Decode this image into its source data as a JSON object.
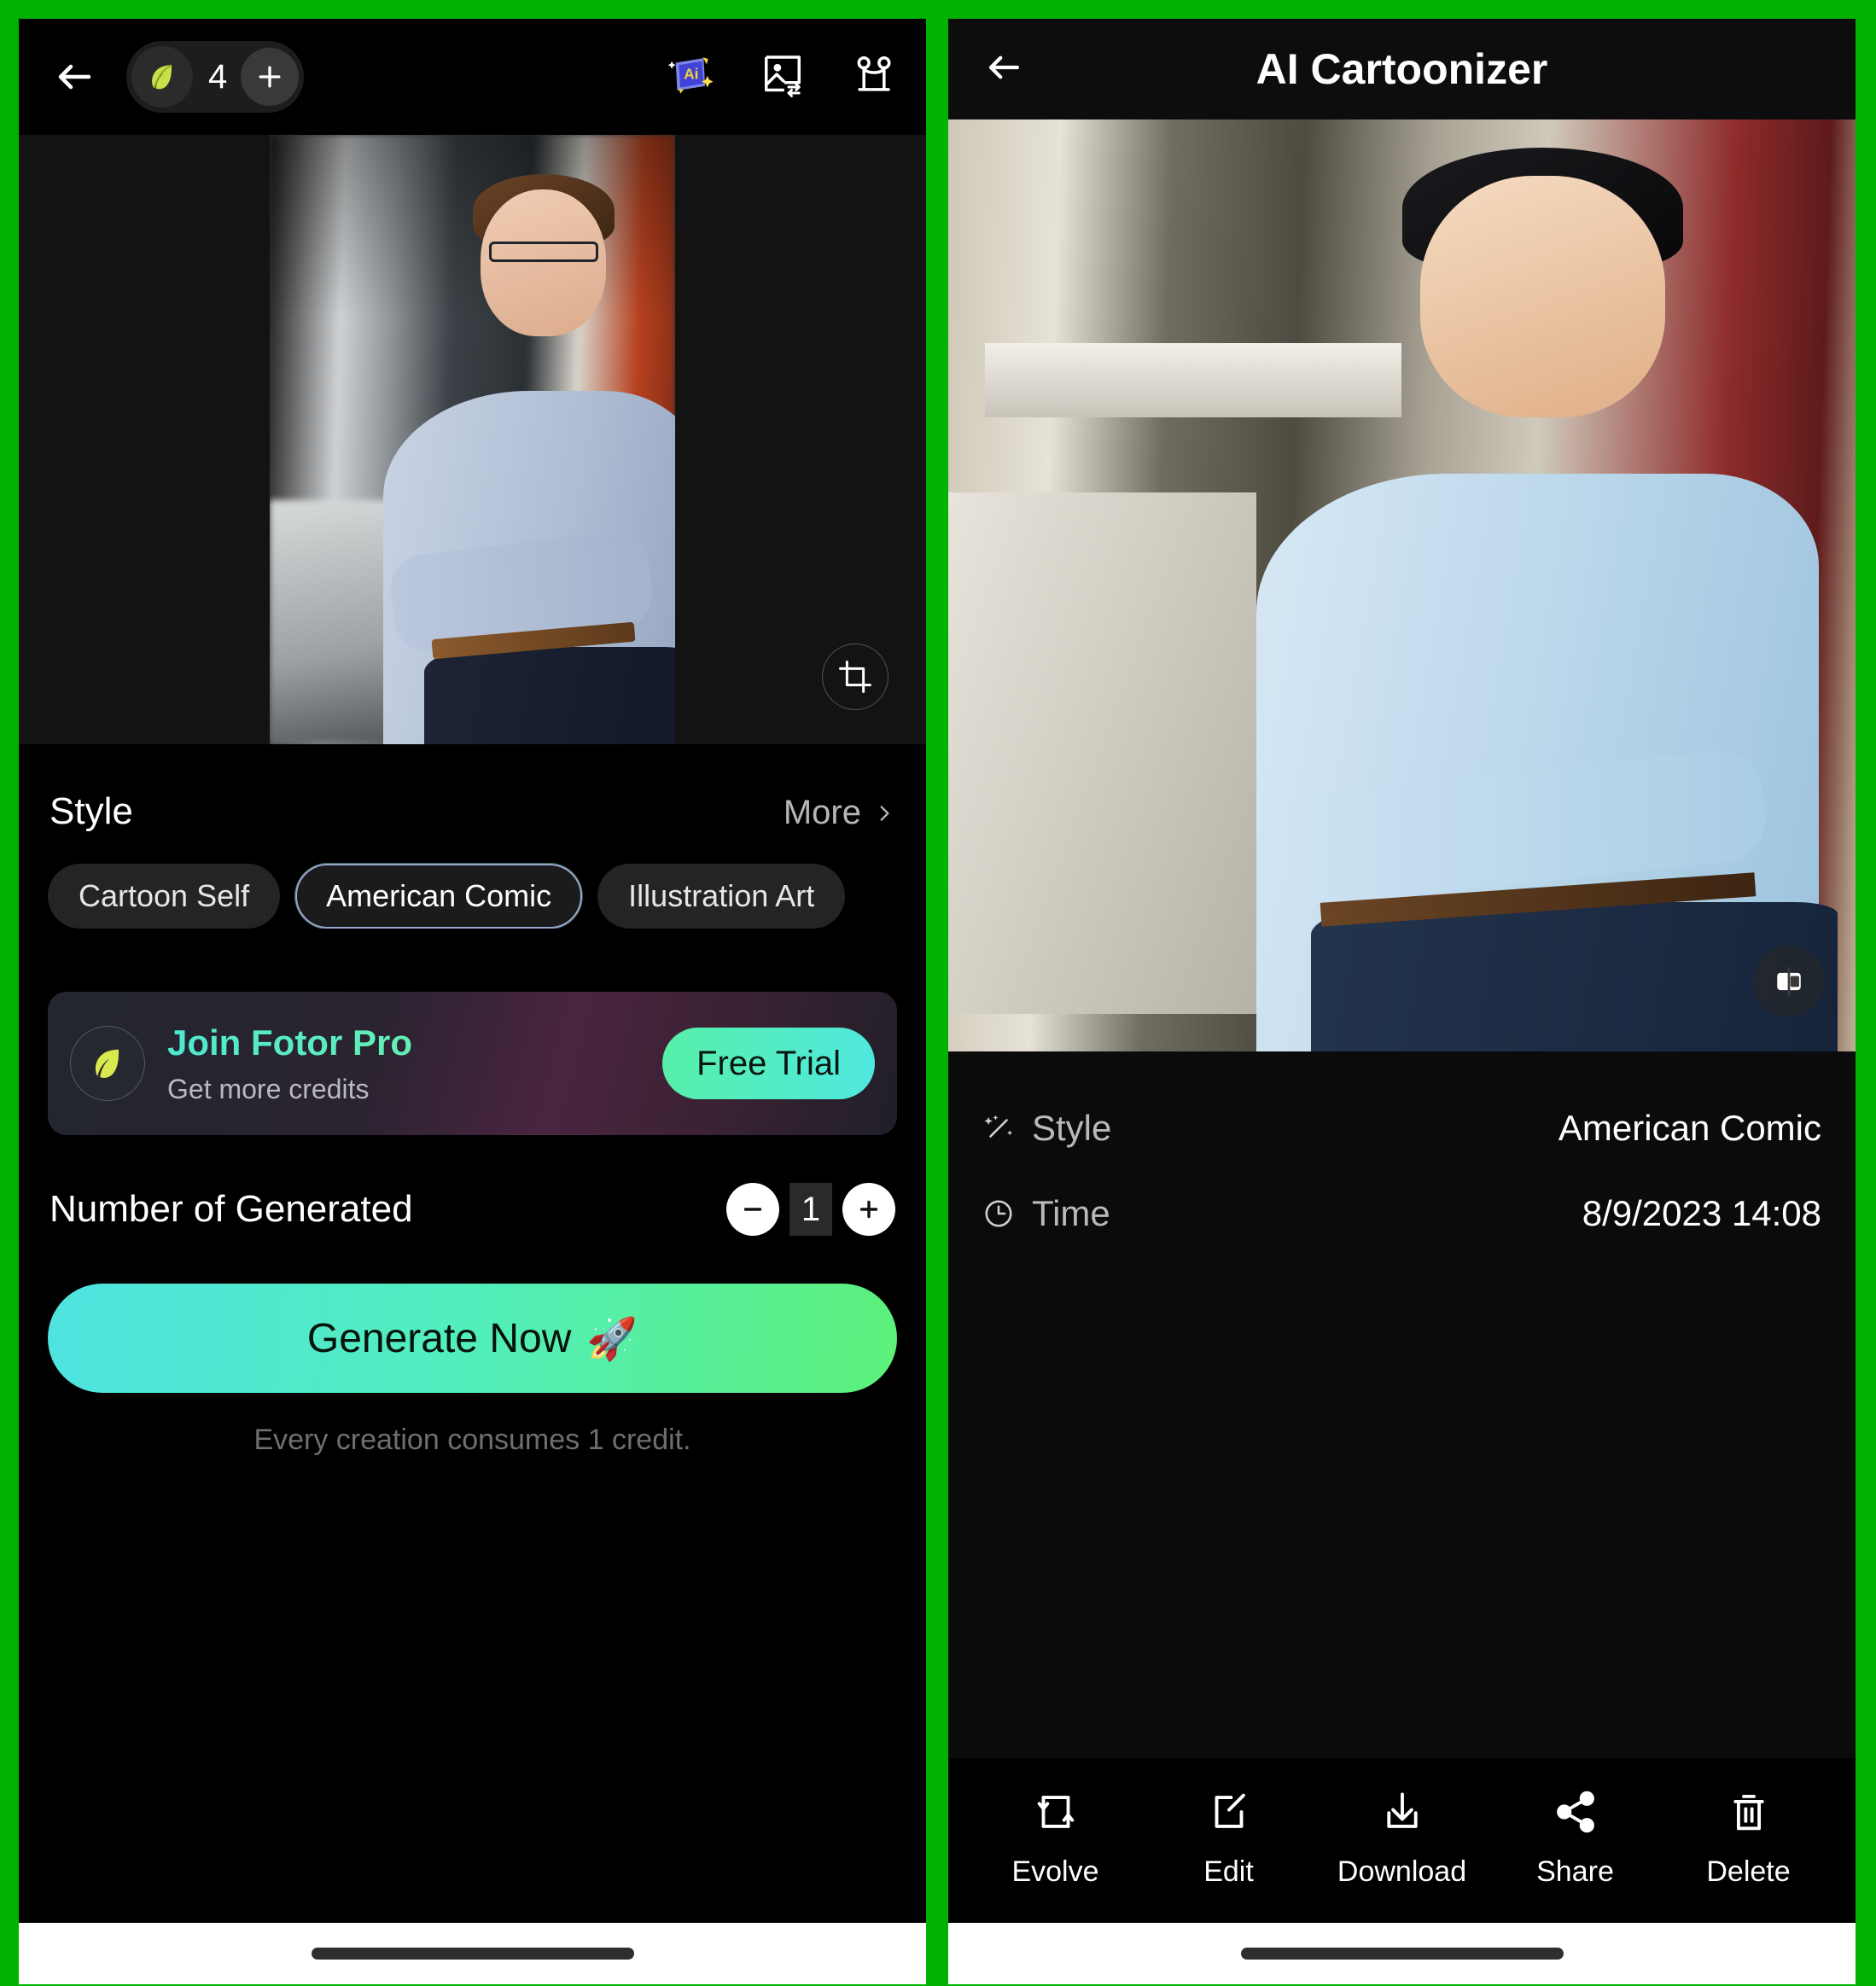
{
  "theme": {
    "divider_color": "#00b300",
    "background": "#000000",
    "accent_gradient_start": "#4fe3e0",
    "accent_gradient_end": "#5cf07a",
    "pro_title_color": "#4ee8d0"
  },
  "left_panel": {
    "topbar": {
      "back_icon": "back-arrow-icon",
      "credits": {
        "icon": "leaf-icon",
        "count": "4",
        "add_label": "+"
      },
      "actions": [
        {
          "icon": "ai-magic-banner-icon",
          "name": "ai-tools"
        },
        {
          "icon": "image-swap-icon",
          "name": "replace-image"
        },
        {
          "icon": "canvas-expand-icon",
          "name": "expand-canvas"
        }
      ]
    },
    "preview": {
      "crop_icon": "crop-icon",
      "alt": "original photo of man in light blue shirt with arms crossed"
    },
    "style_section": {
      "title": "Style",
      "more_label": "More",
      "more_icon": "chevron-right-icon",
      "chips": [
        {
          "label": "Cartoon Self",
          "selected": false
        },
        {
          "label": "American Comic",
          "selected": true
        },
        {
          "label": "Illustration Art",
          "selected": false
        }
      ]
    },
    "pro_banner": {
      "icon": "leaf-icon",
      "title": "Join Fotor Pro",
      "subtitle": "Get more credits",
      "cta": "Free Trial"
    },
    "generate": {
      "count_label": "Number of Generated",
      "minus_label": "−",
      "value": "1",
      "plus_label": "+",
      "button_label": "Generate Now",
      "button_emoji": "🚀",
      "note": "Every creation consumes 1 credit."
    }
  },
  "right_panel": {
    "topbar": {
      "back_icon": "back-arrow-icon",
      "title": "AI Cartoonizer"
    },
    "result": {
      "compare_icon": "compare-split-icon",
      "alt": "cartoonized American Comic style portrait"
    },
    "meta": [
      {
        "icon": "magic-wand-icon",
        "label": "Style",
        "value": "American Comic"
      },
      {
        "icon": "clock-icon",
        "label": "Time",
        "value": "8/9/2023 14:08"
      }
    ],
    "toolbar": [
      {
        "icon": "evolve-loop-icon",
        "label": "Evolve"
      },
      {
        "icon": "edit-pencil-icon",
        "label": "Edit"
      },
      {
        "icon": "download-icon",
        "label": "Download"
      },
      {
        "icon": "share-icon",
        "label": "Share"
      },
      {
        "icon": "trash-icon",
        "label": "Delete"
      }
    ]
  }
}
